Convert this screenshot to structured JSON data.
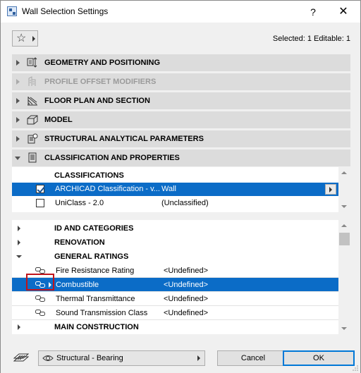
{
  "window": {
    "title": "Wall Selection Settings",
    "help_label": "?",
    "close_label": "✕"
  },
  "toolbar": {
    "favorites_icon": "star-icon",
    "selection_info": "Selected: 1 Editable: 1"
  },
  "sections": [
    {
      "label": "GEOMETRY AND POSITIONING",
      "expanded": false,
      "enabled": true,
      "icon": "geometry-icon"
    },
    {
      "label": "PROFILE OFFSET MODIFIERS",
      "expanded": false,
      "enabled": false,
      "icon": "profile-offset-icon"
    },
    {
      "label": "FLOOR PLAN AND SECTION",
      "expanded": false,
      "enabled": true,
      "icon": "floor-plan-icon"
    },
    {
      "label": "MODEL",
      "expanded": false,
      "enabled": true,
      "icon": "model-icon"
    },
    {
      "label": "STRUCTURAL ANALYTICAL PARAMETERS",
      "expanded": false,
      "enabled": true,
      "icon": "structural-analytical-icon"
    },
    {
      "label": "CLASSIFICATION AND PROPERTIES",
      "expanded": true,
      "enabled": true,
      "icon": "classification-icon"
    }
  ],
  "classifications": {
    "header": "CLASSIFICATIONS",
    "rows": [
      {
        "name": "ARCHICAD Classification - v...",
        "value": "Wall",
        "checked": true,
        "selected": true
      },
      {
        "name": "UniClass - 2.0",
        "value": "(Unclassified)",
        "checked": false,
        "selected": false
      }
    ]
  },
  "properties": {
    "groups": [
      {
        "label": "ID AND CATEGORIES",
        "expanded": false
      },
      {
        "label": "RENOVATION",
        "expanded": false
      },
      {
        "label": "GENERAL RATINGS",
        "expanded": true
      }
    ],
    "items": [
      {
        "name": "Fire Resistance Rating",
        "value": "<Undefined>",
        "selected": false
      },
      {
        "name": "Combustible",
        "value": "<Undefined>",
        "selected": true
      },
      {
        "name": "Thermal Transmittance",
        "value": "<Undefined>",
        "selected": false
      },
      {
        "name": "Sound Transmission Class",
        "value": "<Undefined>",
        "selected": false
      }
    ],
    "trailing_group": {
      "label": "MAIN CONSTRUCTION",
      "expanded": false
    }
  },
  "footer": {
    "layer_value": "Structural - Bearing",
    "cancel_label": "Cancel",
    "ok_label": "OK"
  },
  "colors": {
    "selection": "#0b6cc7",
    "highlight_box": "#c0141b",
    "section_bg": "#dcdcdc"
  }
}
